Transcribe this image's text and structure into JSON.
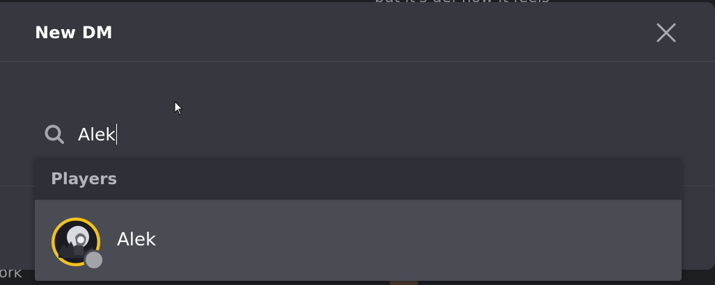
{
  "background": {
    "top_text": "but it's def how it feels",
    "bottom_text": "ork"
  },
  "modal": {
    "title": "New DM",
    "close_icon": "close-icon"
  },
  "search": {
    "icon": "search-icon",
    "value": "Alek"
  },
  "results": {
    "section_label": "Players",
    "items": [
      {
        "name": "Alek",
        "avatar": "player-avatar",
        "status": "offline",
        "status_color": "#a2a4a9"
      }
    ]
  },
  "colors": {
    "modal_bg": "#36373f",
    "dropdown_header_bg": "#2f3037",
    "highlight_row_bg": "#4a4c54",
    "avatar_ring": "#f2c21b"
  }
}
